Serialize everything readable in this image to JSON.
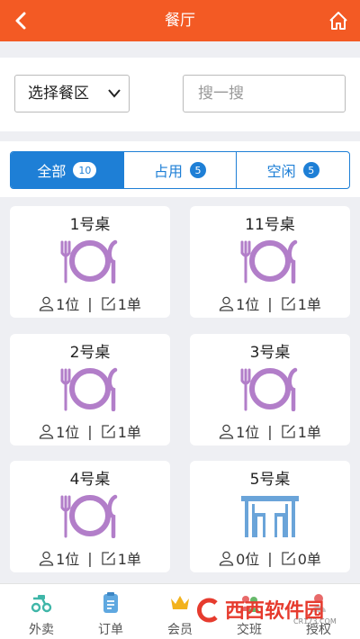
{
  "header": {
    "title": "餐厅",
    "back_icon": "chevron-left-icon",
    "home_icon": "home-icon"
  },
  "filter": {
    "area_select": "选择餐区",
    "search_placeholder": "搜一搜"
  },
  "tabs": [
    {
      "label": "全部",
      "count": "10",
      "active": true
    },
    {
      "label": "占用",
      "count": "5",
      "active": false
    },
    {
      "label": "空闲",
      "count": "5",
      "active": false
    }
  ],
  "tables": [
    {
      "name": "1号桌",
      "guests": "1位",
      "orders": "1单",
      "status": "occupied"
    },
    {
      "name": "11号桌",
      "guests": "1位",
      "orders": "1单",
      "status": "occupied"
    },
    {
      "name": "2号桌",
      "guests": "1位",
      "orders": "1单",
      "status": "occupied"
    },
    {
      "name": "3号桌",
      "guests": "1位",
      "orders": "1单",
      "status": "occupied"
    },
    {
      "name": "4号桌",
      "guests": "1位",
      "orders": "1单",
      "status": "occupied"
    },
    {
      "name": "5号桌",
      "guests": "0位",
      "orders": "0单",
      "status": "free"
    }
  ],
  "meta_separator": "|",
  "bottom_nav": [
    {
      "label": "外卖",
      "icon": "delivery-icon"
    },
    {
      "label": "订单",
      "icon": "order-icon"
    },
    {
      "label": "会员",
      "icon": "crown-icon"
    },
    {
      "label": "交班",
      "icon": "handover-icon"
    },
    {
      "label": "授权",
      "icon": "auth-icon"
    }
  ],
  "watermark": {
    "text": "西西软件园",
    "sub": "CR173.COM"
  },
  "colors": {
    "header": "#f35a24",
    "accent": "#1e7fd6",
    "plate": "#b27ec9",
    "table_free": "#6aa4d9"
  }
}
